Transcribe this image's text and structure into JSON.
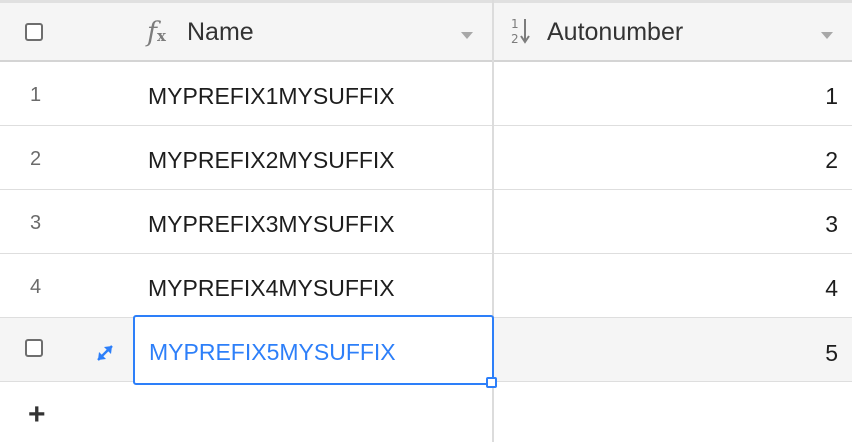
{
  "header": {
    "name_label": "Name",
    "autonumber_label": "Autonumber",
    "name_icon": "formula-fx-icon",
    "autonumber_icon": "autonumber-sort-icon"
  },
  "rows": [
    {
      "row_number": "1",
      "name": "MYPREFIX1MYSUFFIX",
      "autonumber": "1"
    },
    {
      "row_number": "2",
      "name": "MYPREFIX2MYSUFFIX",
      "autonumber": "2"
    },
    {
      "row_number": "3",
      "name": "MYPREFIX3MYSUFFIX",
      "autonumber": "3"
    },
    {
      "row_number": "4",
      "name": "MYPREFIX4MYSUFFIX",
      "autonumber": "4"
    },
    {
      "row_number": "",
      "name": "MYPREFIX5MYSUFFIX",
      "autonumber": "5"
    }
  ],
  "add_row_label": "+",
  "colors": {
    "accent": "#2d7ff9",
    "header_bg": "#f5f5f5",
    "grid_line": "#dedede"
  }
}
